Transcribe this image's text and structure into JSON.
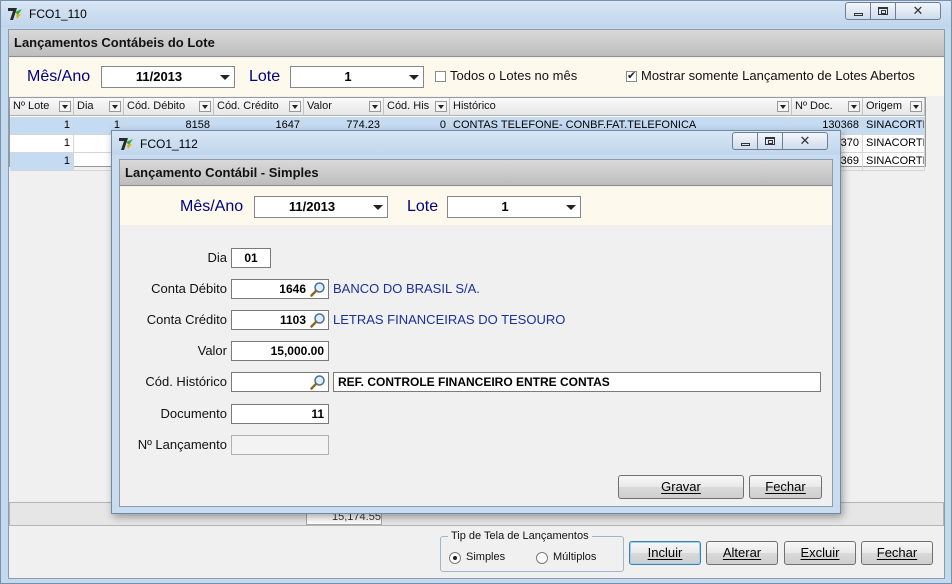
{
  "main_window": {
    "title": "FCO1_110",
    "panel_title": "Lançamentos Contábeis do Lote",
    "mes_ano_label": "Mês/Ano",
    "mes_ano_value": "11/2013",
    "lote_label": "Lote",
    "lote_value": "1",
    "todos_lotes_label": "Todos o Lotes no mês",
    "todos_lotes_checked": false,
    "somente_abertos_label": "Mostrar somente Lançamento de Lotes Abertos",
    "somente_abertos_checked": true,
    "grid": {
      "columns": [
        "Nº Lote",
        "Dia",
        "Cód. Débito",
        "Cód. Crédito",
        "Valor",
        "Cód. His",
        "Histórico",
        "Nº Doc.",
        "Origem"
      ],
      "rows": [
        [
          "1",
          "1",
          "8158",
          "1647",
          "774.23",
          "0",
          "CONTAS TELEFONE- CONBF.FAT.TELEFONICA",
          "130368",
          "SINACORTE"
        ],
        [
          "1",
          "",
          "",
          "",
          "",
          "",
          "",
          "370",
          "SINACORTE"
        ],
        [
          "1",
          "",
          "",
          "",
          "",
          "",
          "",
          "369",
          "SINACORTE"
        ]
      ]
    },
    "total_value": "15,174.55",
    "tipo_tela_group": "Tip de Tela de Lançamentos",
    "radio_simples": "Simples",
    "radio_multiplos": "Múltiplos",
    "radio_selected": "simples",
    "buttons": {
      "incluir": "Incluir",
      "alterar": "Alterar",
      "excluir": "Excluir",
      "fechar": "Fechar"
    }
  },
  "dialog": {
    "title": "FCO1_112",
    "panel_title": "Lançamento Contábil - Simples",
    "mes_ano_label": "Mês/Ano",
    "mes_ano_value": "11/2013",
    "lote_label": "Lote",
    "lote_value": "1",
    "dia_label": "Dia",
    "dia_value": "01",
    "conta_debito_label": "Conta Débito",
    "conta_debito_value": "1646",
    "conta_debito_desc": "BANCO DO BRASIL S/A.",
    "conta_credito_label": "Conta Crédito",
    "conta_credito_value": "1103",
    "conta_credito_desc": "LETRAS FINANCEIRAS DO TESOURO",
    "valor_label": "Valor",
    "valor_value": "15,000.00",
    "cod_historico_label": "Cód. Histórico",
    "cod_historico_value": "",
    "historico_text": "REF. CONTROLE FINANCEIRO ENTRE CONTAS",
    "documento_label": "Documento",
    "documento_value": "11",
    "n_lancamento_label": "Nº Lançamento",
    "n_lancamento_value": "",
    "buttons": {
      "gravar": "Gravar",
      "fechar": "Fechar"
    }
  },
  "icons": {
    "app": "app-logo-icon",
    "lookup": "magnifier-icon",
    "minimize": "minimize-icon",
    "maximize": "maximize-icon",
    "close": "close-icon"
  },
  "colors": {
    "label_blue": "#000080",
    "desc_blue": "#1d2f9a",
    "selected_row": "#c5dbf2",
    "cream_band": "#fdf9ec"
  }
}
